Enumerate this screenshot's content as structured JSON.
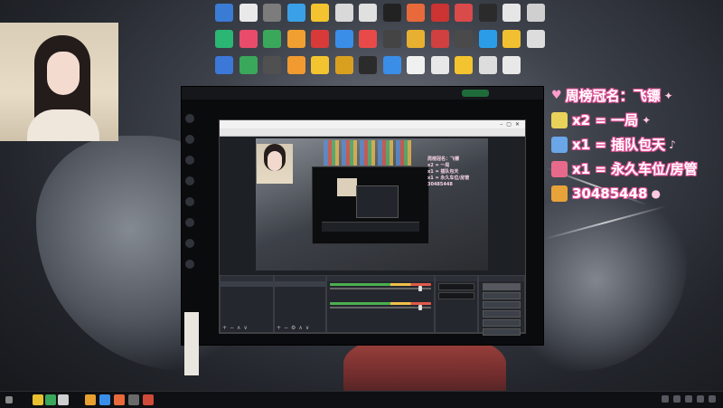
{
  "overlay": {
    "line1": "周榜冠名：飞镖",
    "line2": "x2 = 一局",
    "line3": "x1 = 插队包天",
    "line4": "x1 = 永久车位/房管",
    "line5": "30485448",
    "icon_colors": [
      "#e8d25a",
      "#6aa6e8",
      "#e86a8a",
      "#e8a23a"
    ]
  },
  "obs": {
    "preview_overlay": [
      "周榜冠名：飞镖",
      "x2 = 一局",
      "x1 = 插队包天",
      "x1 = 永久车位/房管",
      "30485448"
    ]
  },
  "desktop": {
    "icon_rows": [
      [
        "#3a7bd5",
        "#e9e9e9",
        "#7c7c7c",
        "#3aa0e8",
        "#f4c430",
        "#d9d9d9",
        "#e0e0e0",
        "#222222",
        "#e86a3a",
        "#cc3333",
        "#d94a4a",
        "#2b2b2b",
        "#e6e6e6",
        "#cfcfcf"
      ],
      [
        "#2bb673",
        "#e94b6a",
        "#3aa85a",
        "#f0a030",
        "#d83a3a",
        "#3a8ee8",
        "#e84a4a",
        "#444444",
        "#e8b030",
        "#d04040",
        "#4a4a4a",
        "#2b9de8",
        "#f0c030",
        "#dddddd"
      ],
      [
        "#3c78d8",
        "#3aa85a",
        "#505050",
        "#f09a30",
        "#f4c430",
        "#d9a020",
        "#2b2b2b",
        "#3a8ee8",
        "#f0f0f0",
        "#e8e8e8",
        "#f4c430",
        "#dddddd",
        "#e8e8e8"
      ]
    ]
  },
  "taskbar": {
    "icon_colors": [
      "#888888",
      "#e8c030",
      "#3aa85a",
      "#cfcfcf",
      "#e8a030",
      "#3a8ee8",
      "#e86a3a",
      "#6a6a6a",
      "#d04a3a"
    ]
  }
}
